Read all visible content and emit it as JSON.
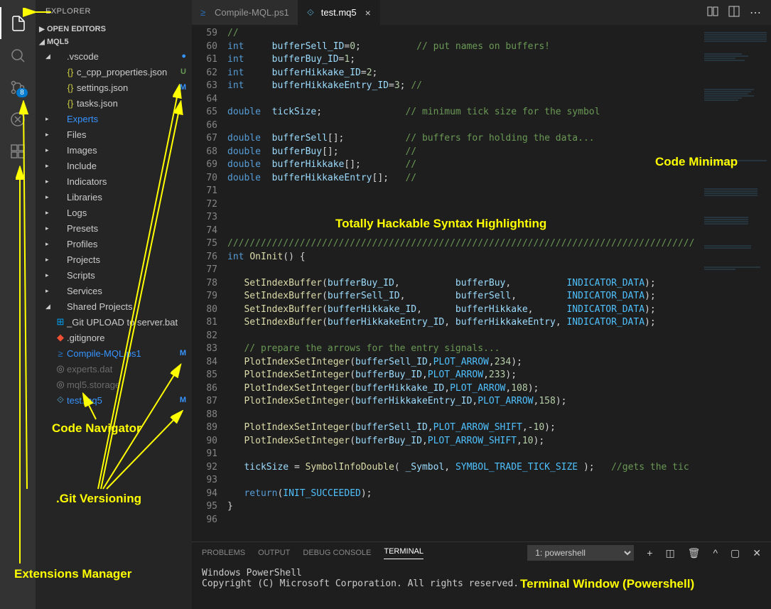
{
  "sidebar": {
    "title": "EXPLORER",
    "open_editors": "OPEN EDITORS",
    "root": "MQL5",
    "items": [
      {
        "kind": "folder",
        "open": true,
        "label": ".vscode",
        "indent": 1,
        "status_dot": true
      },
      {
        "kind": "file",
        "label": "c_cpp_properties.json",
        "indent": 2,
        "color": "yellow-brace",
        "status": "U",
        "status_color": "#6a9955"
      },
      {
        "kind": "file",
        "label": "settings.json",
        "indent": 2,
        "color": "yellow-brace",
        "status": "M",
        "status_color": "#3794ff"
      },
      {
        "kind": "file",
        "label": "tasks.json",
        "indent": 2,
        "color": "yellow-brace"
      },
      {
        "kind": "folder",
        "open": false,
        "label": "Experts",
        "indent": 1,
        "blue": true
      },
      {
        "kind": "folder",
        "open": false,
        "label": "Files",
        "indent": 1
      },
      {
        "kind": "folder",
        "open": false,
        "label": "Images",
        "indent": 1
      },
      {
        "kind": "folder",
        "open": false,
        "label": "Include",
        "indent": 1
      },
      {
        "kind": "folder",
        "open": false,
        "label": "Indicators",
        "indent": 1
      },
      {
        "kind": "folder",
        "open": false,
        "label": "Libraries",
        "indent": 1
      },
      {
        "kind": "folder",
        "open": false,
        "label": "Logs",
        "indent": 1
      },
      {
        "kind": "folder",
        "open": false,
        "label": "Presets",
        "indent": 1
      },
      {
        "kind": "folder",
        "open": false,
        "label": "Profiles",
        "indent": 1
      },
      {
        "kind": "folder",
        "open": false,
        "label": "Projects",
        "indent": 1
      },
      {
        "kind": "folder",
        "open": false,
        "label": "Scripts",
        "indent": 1
      },
      {
        "kind": "folder",
        "open": false,
        "label": "Services",
        "indent": 1
      },
      {
        "kind": "folder",
        "open": true,
        "label": "Shared Projects",
        "indent": 1
      },
      {
        "kind": "file",
        "label": "_Git UPLOAD to server.bat",
        "indent": 1,
        "ico": "win"
      },
      {
        "kind": "file",
        "label": ".gitignore",
        "indent": 1,
        "ico": "git"
      },
      {
        "kind": "file",
        "label": "Compile-MQL.ps1",
        "indent": 1,
        "ico": "ps",
        "blue": true,
        "status": "M",
        "status_color": "#3794ff"
      },
      {
        "kind": "file",
        "label": "experts.dat",
        "indent": 1,
        "dim": true
      },
      {
        "kind": "file",
        "label": "mql5.storage",
        "indent": 1,
        "dim": true
      },
      {
        "kind": "file",
        "label": "test.mq5",
        "indent": 1,
        "ico": "mq",
        "blue": true,
        "status": "M",
        "status_color": "#3794ff"
      }
    ]
  },
  "tabs": [
    {
      "label": "Compile-MQL.ps1",
      "active": false,
      "ico": "ps"
    },
    {
      "label": "test.mq5",
      "active": true,
      "ico": "mq"
    }
  ],
  "scm_badge": "8",
  "code_start_line": 59,
  "code_lines": [
    "<span class='c'>//</span>",
    "<span class='k'>int</span>     <span class='id'>bufferSell_ID</span><span class='d'>=</span><span class='n'>0</span><span class='d'>;</span>          <span class='c'>// put names on buffers!</span>",
    "<span class='k'>int</span>     <span class='id'>bufferBuy_ID</span><span class='d'>=</span><span class='n'>1</span><span class='d'>;</span>",
    "<span class='k'>int</span>     <span class='id'>bufferHikkake_ID</span><span class='d'>=</span><span class='n'>2</span><span class='d'>;</span>",
    "<span class='k'>int</span>     <span class='id'>bufferHikkakeEntry_ID</span><span class='d'>=</span><span class='n'>3</span><span class='d'>;</span> <span class='c'>//</span>",
    "",
    "<span class='k'>double</span>  <span class='id'>tickSize</span><span class='d'>;</span>               <span class='c'>// minimum tick size for the symbol</span>",
    "",
    "<span class='k'>double</span>  <span class='id'>bufferSell</span><span class='d'>[];</span>           <span class='c'>// buffers for holding the data...</span>",
    "<span class='k'>double</span>  <span class='id'>bufferBuy</span><span class='d'>[];</span>            <span class='c'>//</span>",
    "<span class='k'>double</span>  <span class='id'>bufferHikkake</span><span class='d'>[];</span>        <span class='c'>//</span>",
    "<span class='k'>double</span>  <span class='id'>bufferHikkakeEntry</span><span class='d'>[];</span>   <span class='c'>//</span>",
    "",
    "",
    "",
    "",
    "<span class='c'>////////////////////////////////////////////////////////////////////////////////////</span>",
    "<span class='k'>int</span> <span class='f'>OnInit</span><span class='d'>() {</span>",
    "",
    "   <span class='f'>SetIndexBuffer</span><span class='d'>(</span><span class='id'>bufferBuy_ID</span><span class='d'>,          </span><span class='id'>bufferBuy</span><span class='d'>,          </span><span class='const'>INDICATOR_DATA</span><span class='d'>);</span>",
    "   <span class='f'>SetIndexBuffer</span><span class='d'>(</span><span class='id'>bufferSell_ID</span><span class='d'>,         </span><span class='id'>bufferSell</span><span class='d'>,         </span><span class='const'>INDICATOR_DATA</span><span class='d'>);</span>",
    "   <span class='f'>SetIndexBuffer</span><span class='d'>(</span><span class='id'>bufferHikkake_ID</span><span class='d'>,      </span><span class='id'>bufferHikkake</span><span class='d'>,      </span><span class='const'>INDICATOR_DATA</span><span class='d'>);</span>",
    "   <span class='f'>SetIndexBuffer</span><span class='d'>(</span><span class='id'>bufferHikkakeEntry_ID</span><span class='d'>, </span><span class='id'>bufferHikkakeEntry</span><span class='d'>, </span><span class='const'>INDICATOR_DATA</span><span class='d'>);</span>",
    "",
    "   <span class='c'>// prepare the arrows for the entry signals...</span>",
    "   <span class='f'>PlotIndexSetInteger</span><span class='d'>(</span><span class='id'>bufferSell_ID</span><span class='d'>,</span><span class='const'>PLOT_ARROW</span><span class='d'>,</span><span class='n'>234</span><span class='d'>);</span>",
    "   <span class='f'>PlotIndexSetInteger</span><span class='d'>(</span><span class='id'>bufferBuy_ID</span><span class='d'>,</span><span class='const'>PLOT_ARROW</span><span class='d'>,</span><span class='n'>233</span><span class='d'>);</span>",
    "   <span class='f'>PlotIndexSetInteger</span><span class='d'>(</span><span class='id'>bufferHikkake_ID</span><span class='d'>,</span><span class='const'>PLOT_ARROW</span><span class='d'>,</span><span class='n'>108</span><span class='d'>);</span>",
    "   <span class='f'>PlotIndexSetInteger</span><span class='d'>(</span><span class='id'>bufferHikkakeEntry_ID</span><span class='d'>,</span><span class='const'>PLOT_ARROW</span><span class='d'>,</span><span class='n'>158</span><span class='d'>);</span>",
    "",
    "   <span class='f'>PlotIndexSetInteger</span><span class='d'>(</span><span class='id'>bufferSell_ID</span><span class='d'>,</span><span class='const'>PLOT_ARROW_SHIFT</span><span class='d'>,-</span><span class='n'>10</span><span class='d'>);</span>",
    "   <span class='f'>PlotIndexSetInteger</span><span class='d'>(</span><span class='id'>bufferBuy_ID</span><span class='d'>,</span><span class='const'>PLOT_ARROW_SHIFT</span><span class='d'>,</span><span class='n'>10</span><span class='d'>);</span>",
    "",
    "   <span class='id'>tickSize</span> <span class='d'>=</span> <span class='f'>SymbolInfoDouble</span><span class='d'>( </span><span class='id'>_Symbol</span><span class='d'>, </span><span class='const'>SYMBOL_TRADE_TICK_SIZE</span><span class='d'> );   </span><span class='c'>//gets the tic</span>",
    "",
    "   <span class='k'>return</span><span class='d'>(</span><span class='const'>INIT_SUCCEEDED</span><span class='d'>);</span>",
    "<span class='d'>}</span>",
    ""
  ],
  "panel": {
    "tabs": [
      "PROBLEMS",
      "OUTPUT",
      "DEBUG CONSOLE",
      "TERMINAL"
    ],
    "active": "TERMINAL",
    "dropdown": "1: powershell",
    "body": "Windows PowerShell\nCopyright (C) Microsoft Corporation. All rights reserved."
  },
  "annotations": {
    "explorer": "",
    "code_nav": "Code Navigator",
    "git": ".Git Versioning",
    "ext": "Extensions Manager",
    "syntax": "Totally Hackable Syntax Highlighting",
    "minimap": "Code Minimap",
    "terminal": "Terminal Window (Powershell)"
  }
}
